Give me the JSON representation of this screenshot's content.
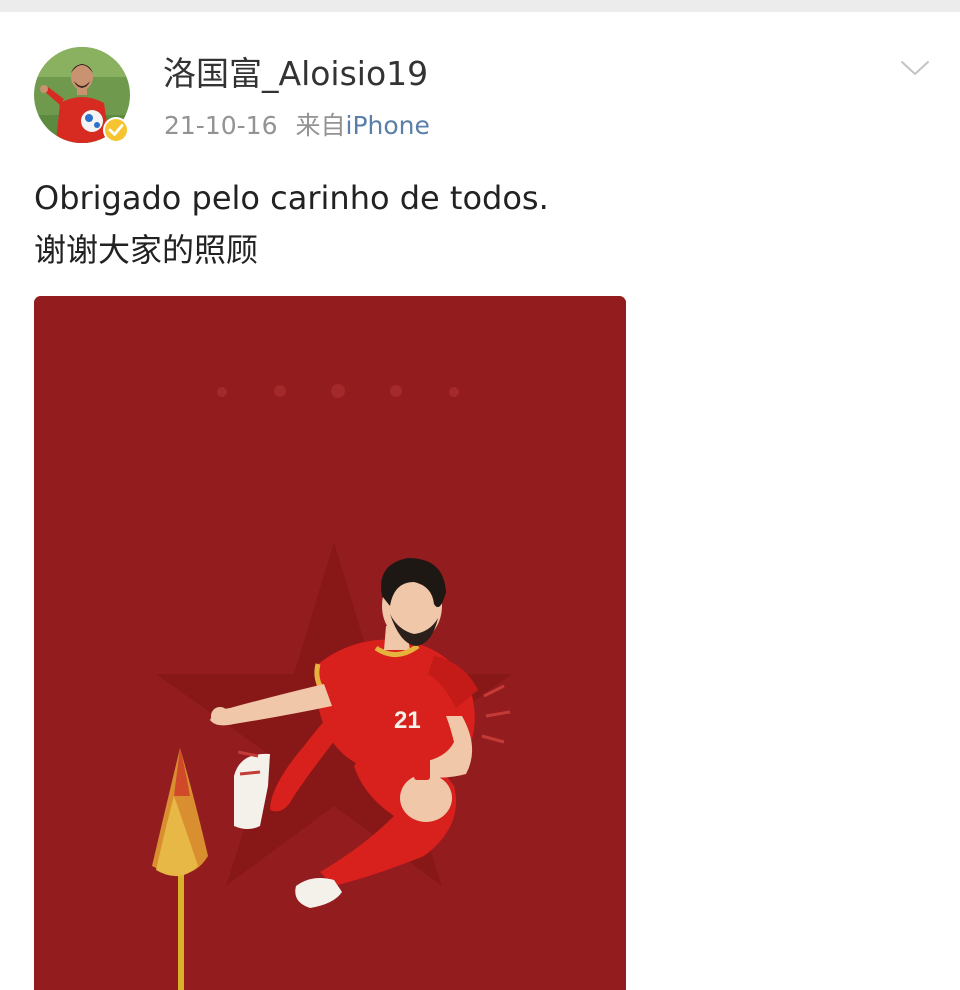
{
  "post": {
    "author": {
      "name": "洛国富_Aloisio19",
      "verified": true
    },
    "date": "21-10-16",
    "source_prefix": "来自",
    "source_device": "iPhone",
    "text_lines": [
      "Obrigado pelo carinho de todos.",
      "谢谢大家的照顾"
    ],
    "image": {
      "jersey_number": "21"
    }
  },
  "icons": {
    "menu": "chevron-down-icon",
    "verified": "verified-badge-icon"
  },
  "colors": {
    "image_background": "#931c1f",
    "verified_badge": "#f6c431",
    "link": "#5b7fa8",
    "meta_gray": "#939393",
    "jersey_red": "#d8201c"
  }
}
